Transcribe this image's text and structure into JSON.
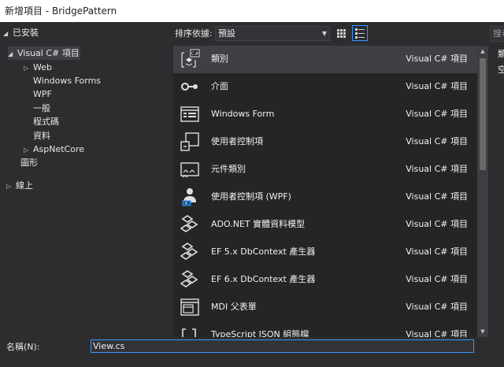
{
  "window": {
    "title": "新增項目 - BridgePattern"
  },
  "tree": {
    "installed": "已安裝",
    "visual_csharp": "Visual C# 項目",
    "web": "Web",
    "windows_forms": "Windows Forms",
    "wpf": "WPF",
    "general": "一般",
    "code": "程式碼",
    "data": "資料",
    "aspnetcore": "AspNetCore",
    "graphics": "圖形",
    "online": "線上"
  },
  "sort": {
    "label": "排序依據:",
    "value": "預設"
  },
  "search": {
    "placeholder": "搜尋"
  },
  "templates": [
    {
      "name": "類別",
      "lang": "Visual C# 項目",
      "icon": "class-icon"
    },
    {
      "name": "介面",
      "lang": "Visual C# 項目",
      "icon": "interface-icon"
    },
    {
      "name": "Windows Form",
      "lang": "Visual C# 項目",
      "icon": "windows-form-icon"
    },
    {
      "name": "使用者控制項",
      "lang": "Visual C# 項目",
      "icon": "user-control-icon"
    },
    {
      "name": "元件類別",
      "lang": "Visual C# 項目",
      "icon": "component-class-icon"
    },
    {
      "name": "使用者控制項 (WPF)",
      "lang": "Visual C# 項目",
      "icon": "wpf-user-control-icon"
    },
    {
      "name": "ADO.NET 實體資料模型",
      "lang": "Visual C# 項目",
      "icon": "ado-net-model-icon"
    },
    {
      "name": "EF 5.x DbContext 產生器",
      "lang": "Visual C# 項目",
      "icon": "ef5-generator-icon"
    },
    {
      "name": "EF 6.x DbContext 產生器",
      "lang": "Visual C# 項目",
      "icon": "ef6-generator-icon"
    },
    {
      "name": "MDI 父表單",
      "lang": "Visual C# 項目",
      "icon": "mdi-parent-form-icon"
    },
    {
      "name": "TypeScript JSON 組態檔",
      "lang": "Visual C# 項目",
      "icon": "typescript-json-icon"
    }
  ],
  "details": {
    "line1": "類",
    "line2": "空"
  },
  "name_field": {
    "label": "名稱(N):",
    "value": "View.cs"
  },
  "colors": {
    "accent": "#3399ff",
    "background": "#2d2d30",
    "list_background": "#252526",
    "selection": "#3f3f46"
  }
}
